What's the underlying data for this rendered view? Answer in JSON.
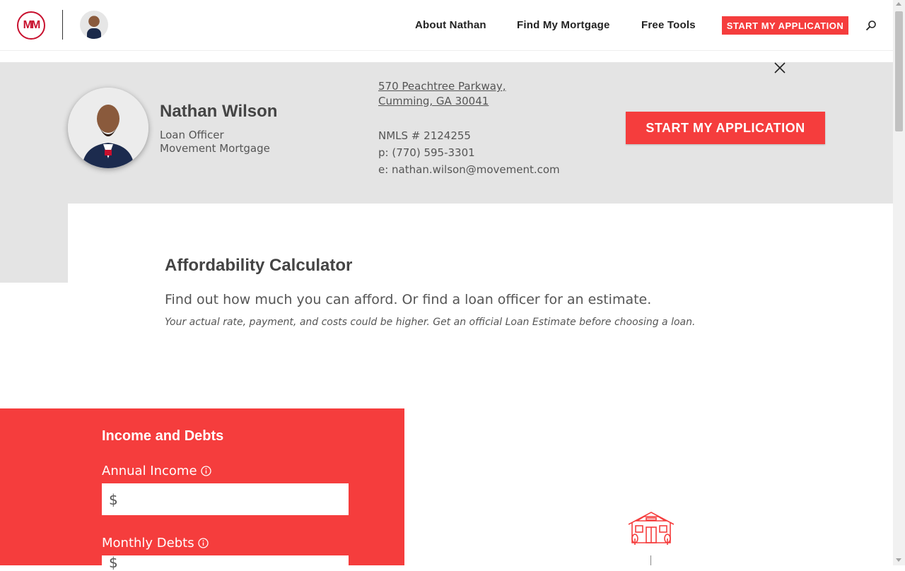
{
  "header": {
    "logo_text": "MM",
    "nav": {
      "about": "About Nathan",
      "find": "Find My Mortgage",
      "tools": "Free Tools"
    },
    "cta": "START MY APPLICATION"
  },
  "profile": {
    "name": "Nathan Wilson",
    "title": "Loan Officer",
    "company": "Movement Mortgage",
    "address_line1": "570 Peachtree Parkway,",
    "address_line2": "Cumming, GA 30041",
    "nmls": "NMLS # 2124255",
    "phone": "p: (770) 595-3301",
    "email": "e: nathan.wilson@movement.com",
    "cta": "START MY APPLICATION"
  },
  "calculator": {
    "title": "Affordability Calculator",
    "subtitle": "Find out how much you can afford. Or find a loan officer for an estimate.",
    "note": "Your actual rate, payment, and costs could be higher. Get an official Loan Estimate before choosing a loan."
  },
  "form": {
    "section_title": "Income and Debts",
    "annual_income_label": "Annual Income",
    "monthly_debts_label": "Monthly Debts",
    "currency_symbol": "$",
    "annual_income_value": "",
    "monthly_debts_value": ""
  },
  "colors": {
    "brand_red": "#f53d3d",
    "band_grey": "#e4e4e4"
  }
}
